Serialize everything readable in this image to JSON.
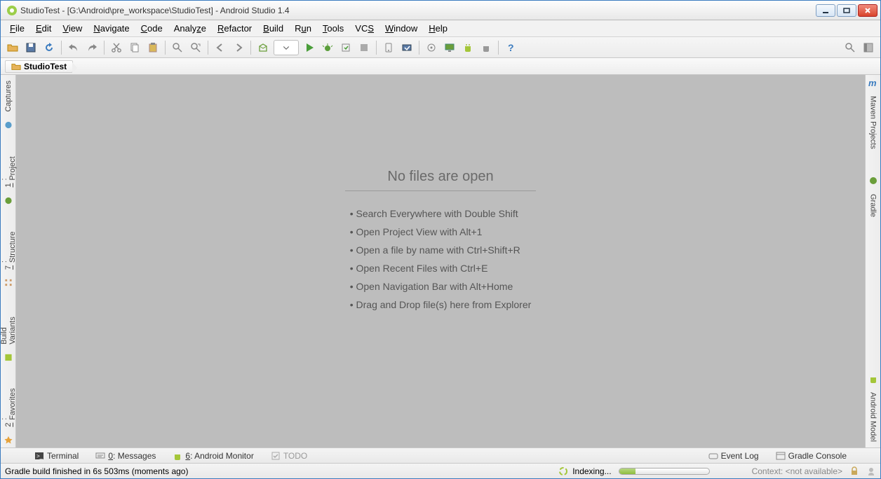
{
  "window": {
    "title": "StudioTest - [G:\\Android\\pre_workspace\\StudioTest] - Android Studio 1.4"
  },
  "menu": [
    "File",
    "Edit",
    "View",
    "Navigate",
    "Code",
    "Analyze",
    "Refactor",
    "Build",
    "Run",
    "Tools",
    "VCS",
    "Window",
    "Help"
  ],
  "breadcrumb": {
    "project": "StudioTest"
  },
  "left_tool_windows": [
    {
      "label": "Captures"
    },
    {
      "label": "1: Project"
    },
    {
      "label": "7: Structure"
    },
    {
      "label": "Build Variants"
    },
    {
      "label": "2: Favorites"
    }
  ],
  "right_tool_windows": [
    {
      "label": "Maven Projects"
    },
    {
      "label": "Gradle"
    },
    {
      "label": "Android Model"
    }
  ],
  "editor": {
    "title": "No files are open",
    "tips": [
      "• Search Everywhere with Double Shift",
      "• Open Project View with Alt+1",
      "• Open a file by name with Ctrl+Shift+R",
      "• Open Recent Files with Ctrl+E",
      "• Open Navigation Bar with Alt+Home",
      "• Drag and Drop file(s) here from Explorer"
    ]
  },
  "bottom_tools": {
    "terminal": "Terminal",
    "messages": "0: Messages",
    "android_monitor": "6: Android Monitor",
    "todo": "TODO",
    "event_log": "Event Log",
    "gradle_console": "Gradle Console"
  },
  "status": {
    "build_msg": "Gradle build finished in 6s 503ms (moments ago)",
    "indexing": "Indexing...",
    "context": "Context: <not available>"
  }
}
